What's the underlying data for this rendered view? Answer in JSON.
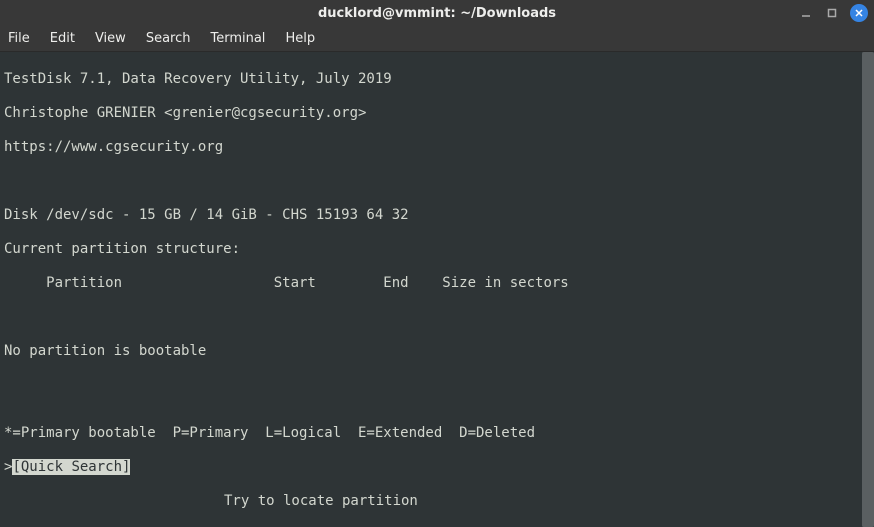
{
  "window": {
    "title": "ducklord@vmmint: ~/Downloads"
  },
  "menu": {
    "file": "File",
    "edit": "Edit",
    "view": "View",
    "search": "Search",
    "terminal": "Terminal",
    "help": "Help"
  },
  "terminal": {
    "line1": "TestDisk 7.1, Data Recovery Utility, July 2019",
    "line2": "Christophe GRENIER <grenier@cgsecurity.org>",
    "line3": "https://www.cgsecurity.org",
    "line4": "",
    "line5": "Disk /dev/sdc - 15 GB / 14 GiB - CHS 15193 64 32",
    "line6": "Current partition structure:",
    "line7": "     Partition                  Start        End    Size in sectors",
    "line8": "",
    "line9": "No partition is bootable",
    "legend": "*=Primary bootable  P=Primary  L=Logical  E=Extended  D=Deleted",
    "prompt_prefix": ">",
    "selected": "[Quick Search]",
    "hint": "Try to locate partition"
  }
}
